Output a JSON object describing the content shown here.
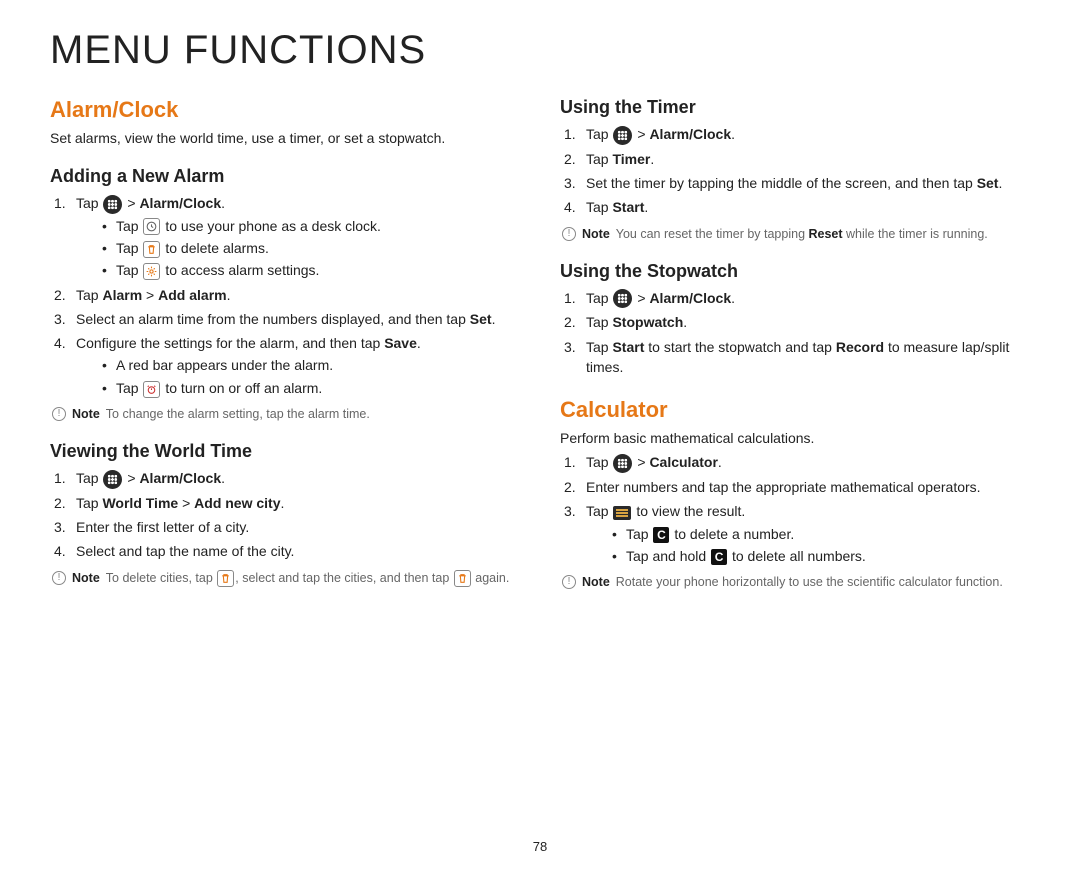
{
  "page_title": "MENU FUNCTIONS",
  "page_number": "78",
  "note_label": "Note",
  "left": {
    "section_alarm": {
      "heading": "Alarm/Clock",
      "intro": "Set alarms, view the world time, use a timer, or set a stopwatch.",
      "adding": {
        "heading": "Adding a New Alarm",
        "step1_pre": "Tap ",
        "step1_mid": " > ",
        "step1_bold": "Alarm/Clock",
        "step1_post": ".",
        "b1_pre": "Tap ",
        "b1_post": " to use your phone as a desk clock.",
        "b2_pre": "Tap ",
        "b2_post": " to delete alarms.",
        "b3_pre": "Tap ",
        "b3_post": " to access alarm settings.",
        "step2_pre": "Tap ",
        "step2_b1": "Alarm",
        "step2_mid": " > ",
        "step2_b2": "Add alarm",
        "step2_post": ".",
        "step3_pre": "Select an alarm time from the numbers displayed, and then tap ",
        "step3_bold": "Set",
        "step3_post": ".",
        "step4_pre": "Configure the settings for the alarm, and then tap ",
        "step4_bold": "Save",
        "step4_post": ".",
        "b4": "A red bar appears under the alarm.",
        "b5_pre": "Tap ",
        "b5_post": " to turn on or off an alarm.",
        "note": "To change the alarm setting, tap the alarm time."
      },
      "world": {
        "heading": "Viewing the World Time",
        "step1_pre": "Tap ",
        "step1_mid": " > ",
        "step1_bold": "Alarm/Clock",
        "step1_post": ".",
        "step2_pre": "Tap ",
        "step2_b1": "World Time",
        "step2_mid": " > ",
        "step2_b2": "Add new city",
        "step2_post": ".",
        "step3": "Enter the first letter of a city.",
        "step4": "Select and tap the name of the city.",
        "note_pre": "To delete cities, tap ",
        "note_mid": ", select and tap the cities, and then tap ",
        "note_post": " again."
      }
    }
  },
  "right": {
    "timer": {
      "heading": "Using the Timer",
      "step1_pre": "Tap ",
      "step1_mid": " > ",
      "step1_bold": "Alarm/Clock",
      "step1_post": ".",
      "step2_pre": "Tap ",
      "step2_bold": "Timer",
      "step2_post": ".",
      "step3_pre": "Set the timer by tapping the middle of the screen, and then tap ",
      "step3_bold": "Set",
      "step3_post": ".",
      "step4_pre": "Tap ",
      "step4_bold": "Start",
      "step4_post": ".",
      "note_pre": "You can reset the timer by tapping ",
      "note_bold": "Reset",
      "note_post": " while the timer is running."
    },
    "stopwatch": {
      "heading": "Using the Stopwatch",
      "step1_pre": "Tap ",
      "step1_mid": " > ",
      "step1_bold": "Alarm/Clock",
      "step1_post": ".",
      "step2_pre": "Tap ",
      "step2_bold": "Stopwatch",
      "step2_post": ".",
      "step3_pre": "Tap ",
      "step3_b1": "Start",
      "step3_mid": " to start the stopwatch and tap ",
      "step3_b2": "Record",
      "step3_post": " to measure lap/split times."
    },
    "calc": {
      "heading": "Calculator",
      "intro": "Perform basic mathematical calculations.",
      "step1_pre": "Tap ",
      "step1_mid": " > ",
      "step1_bold": "Calculator",
      "step1_post": ".",
      "step2": "Enter numbers and tap the appropriate mathematical operators.",
      "step3_pre": "Tap ",
      "step3_post": " to view the result.",
      "b1_pre": "Tap ",
      "b1_post": " to delete a number.",
      "b2_pre": "Tap and hold ",
      "b2_post": " to delete all numbers.",
      "note": "Rotate your phone horizontally to use the scientific calculator function."
    }
  }
}
